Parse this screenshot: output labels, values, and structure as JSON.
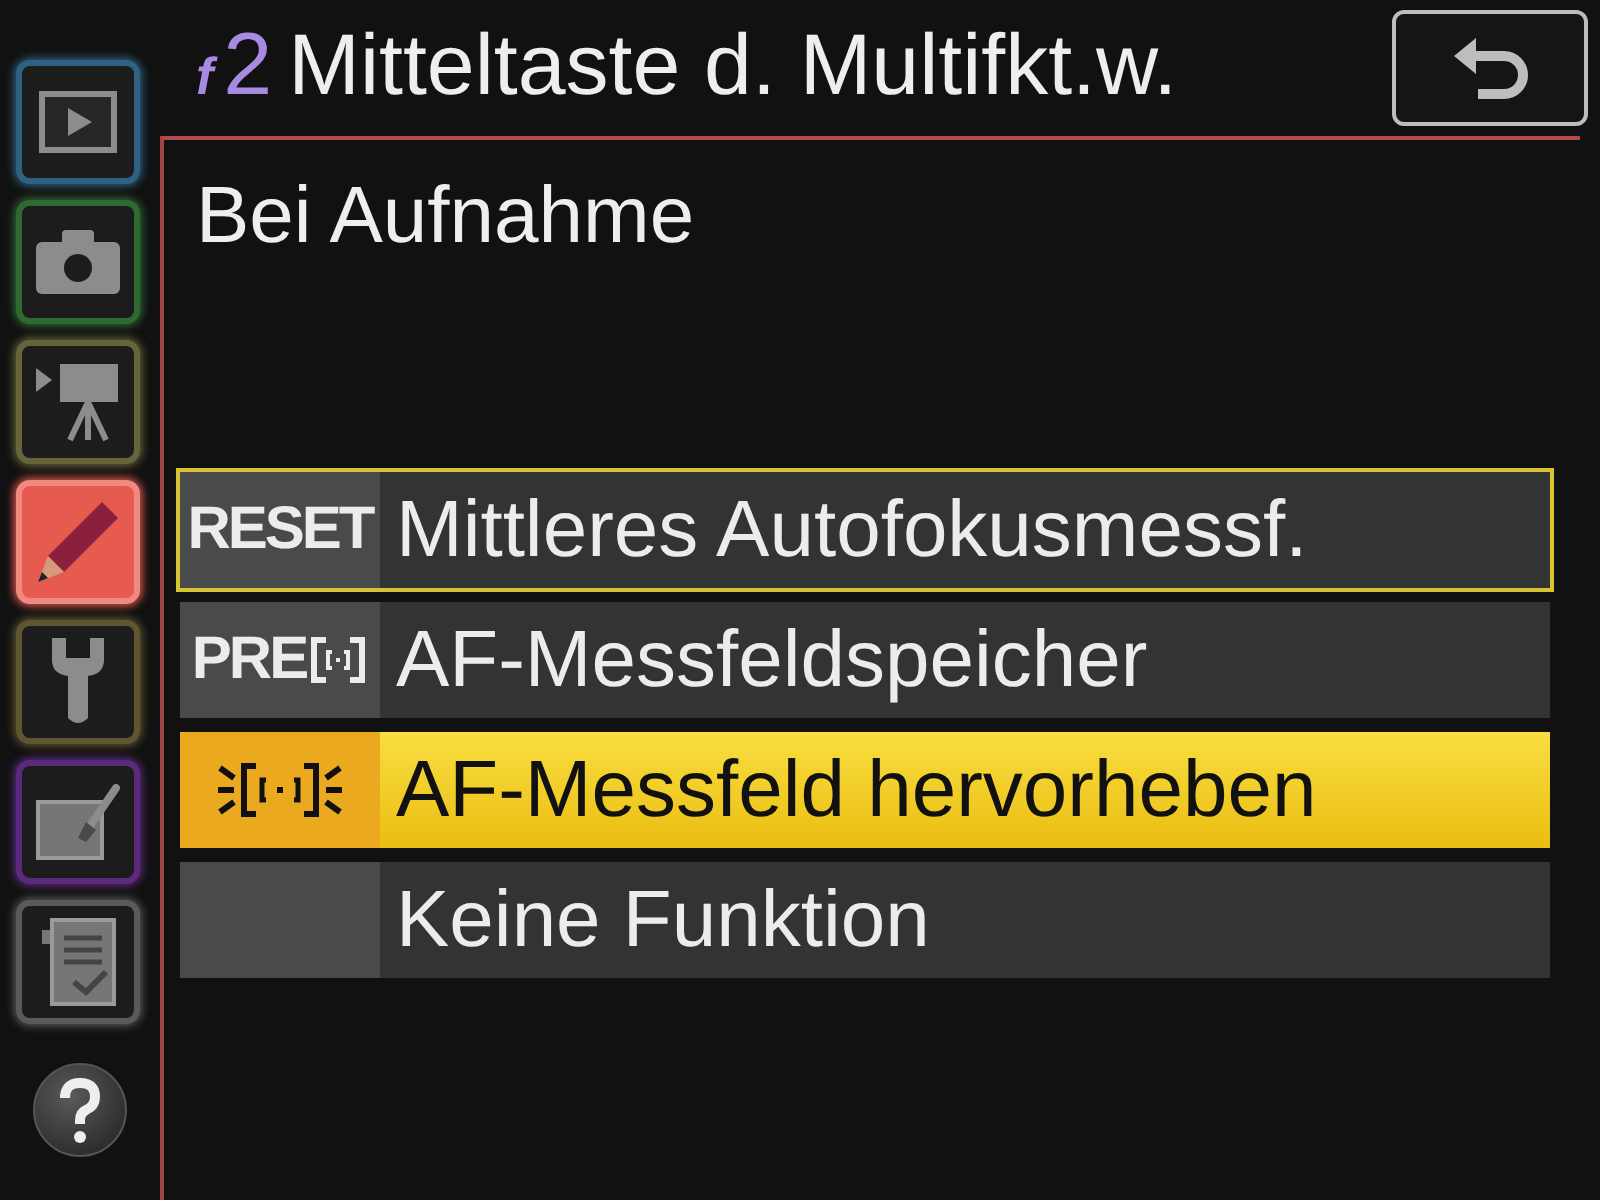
{
  "tabs": [
    {
      "kind": "playback",
      "color": "#2f6282",
      "selected": false
    },
    {
      "kind": "shooting",
      "color": "#2f6a32",
      "selected": false
    },
    {
      "kind": "movie",
      "color": "#66643a",
      "selected": false
    },
    {
      "kind": "custom",
      "color": "#e65a50",
      "selected": true
    },
    {
      "kind": "setup",
      "color": "#5e5630",
      "selected": false
    },
    {
      "kind": "retouch",
      "color": "#5c2a7c",
      "selected": false
    },
    {
      "kind": "my_menu",
      "color": "#5a5a5a",
      "selected": false
    }
  ],
  "title": {
    "section": "f",
    "number": "2",
    "text": "Mitteltaste d. Multifkt.w."
  },
  "subtitle": "Bei Aufnahme",
  "options": [
    {
      "kind": "reset",
      "prefix": "RESET",
      "label": "Mittleres Autofokusmessf.",
      "outlined": true,
      "selected": false
    },
    {
      "kind": "lock",
      "prefix": "PRE",
      "label": "AF-Messfeldspeicher",
      "outlined": false,
      "selected": false
    },
    {
      "kind": "highlight",
      "label": "AF-Messfeld hervorheben",
      "outlined": false,
      "selected": true
    },
    {
      "kind": "none",
      "label": "Keine Funktion",
      "outlined": false,
      "selected": false
    }
  ]
}
